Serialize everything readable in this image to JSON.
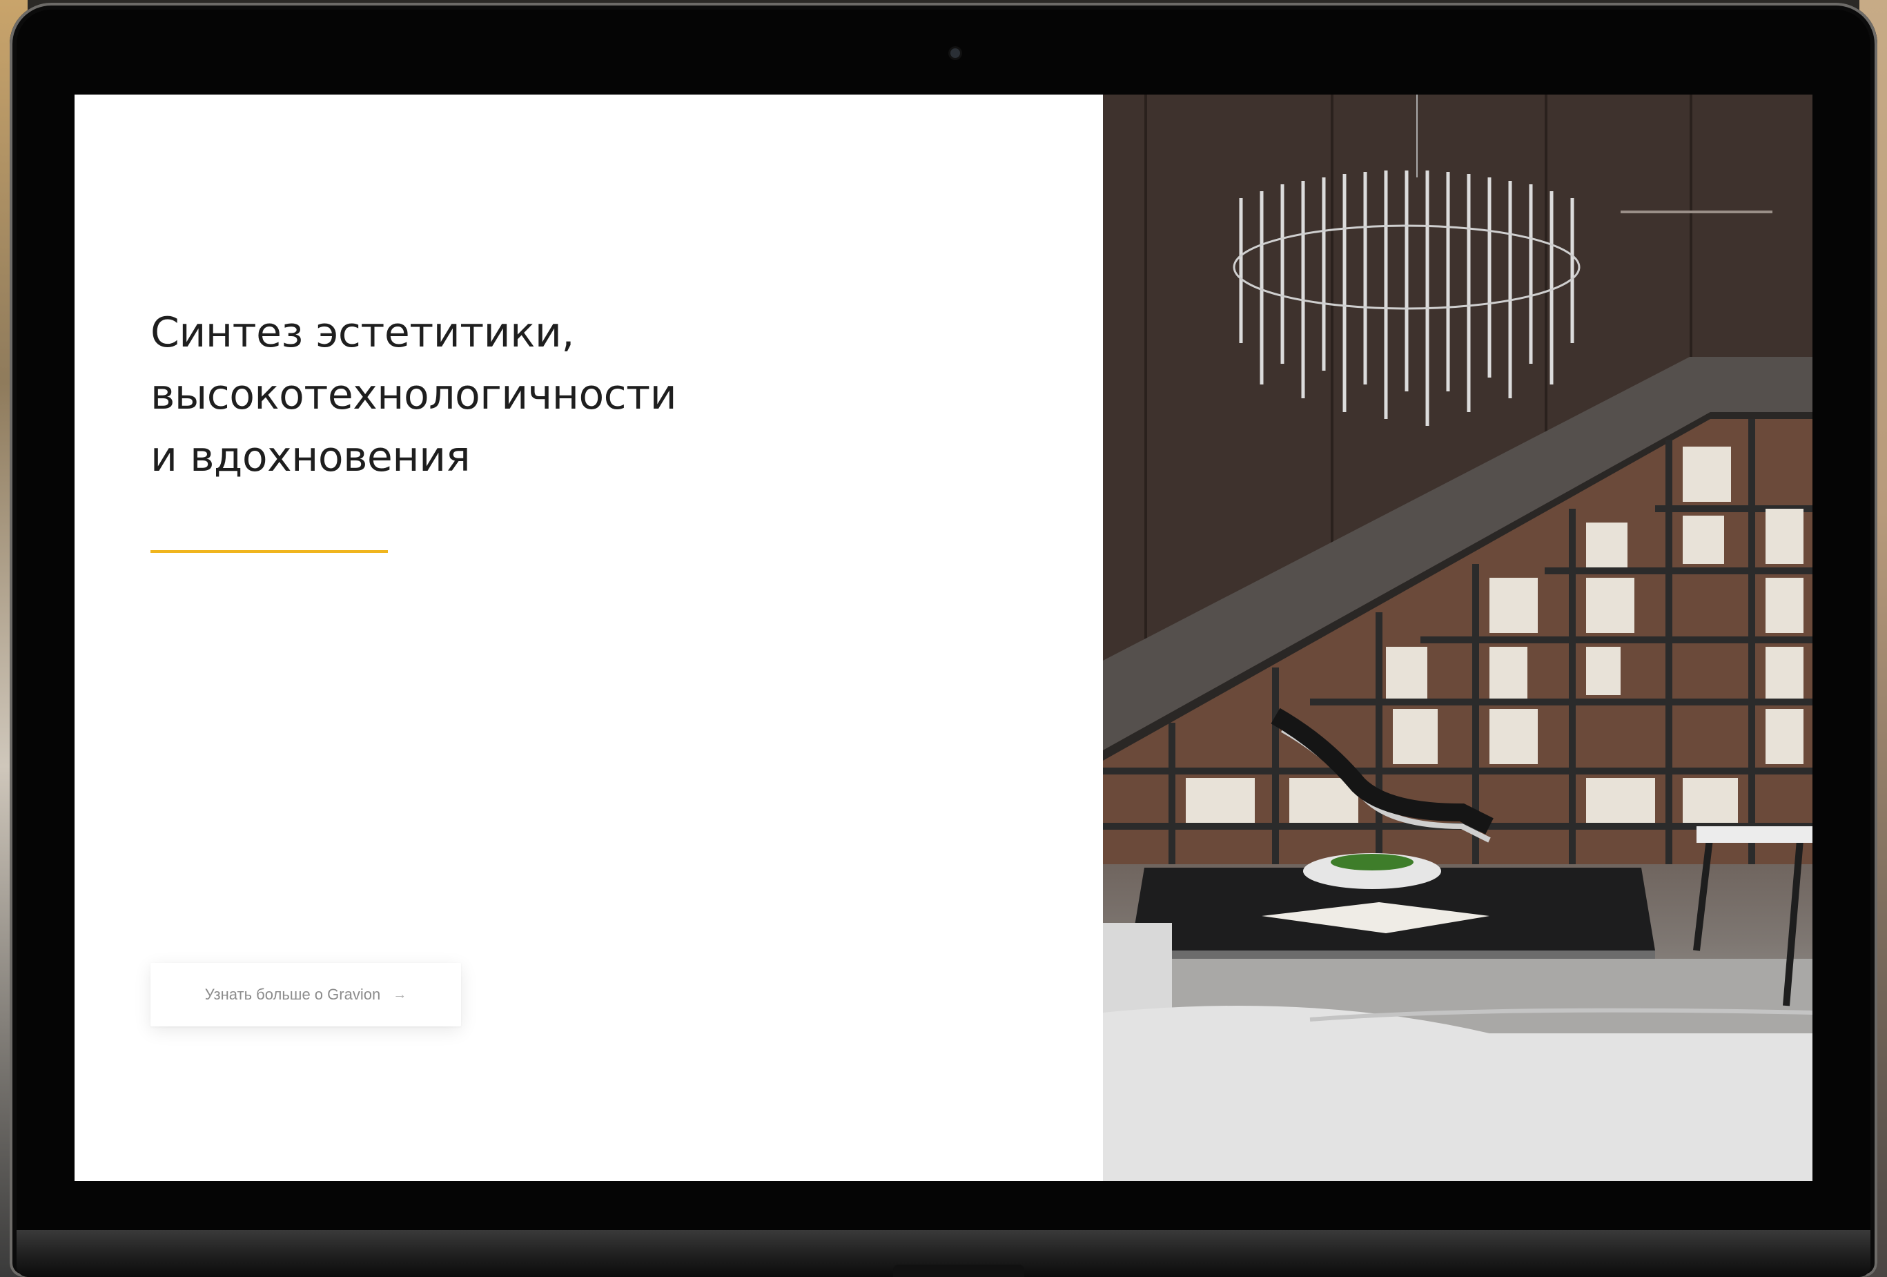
{
  "hero": {
    "headline_lines": [
      "Синтез эстетитики,",
      "высокотехнологичности",
      "и вдохновения"
    ],
    "cta_label": "Узнать больше о Gravion",
    "cta_icon": "arrow-right-icon"
  },
  "colors": {
    "accent": "#f0b51e",
    "text": "#1e1e1e",
    "muted": "#8c8c8c"
  }
}
